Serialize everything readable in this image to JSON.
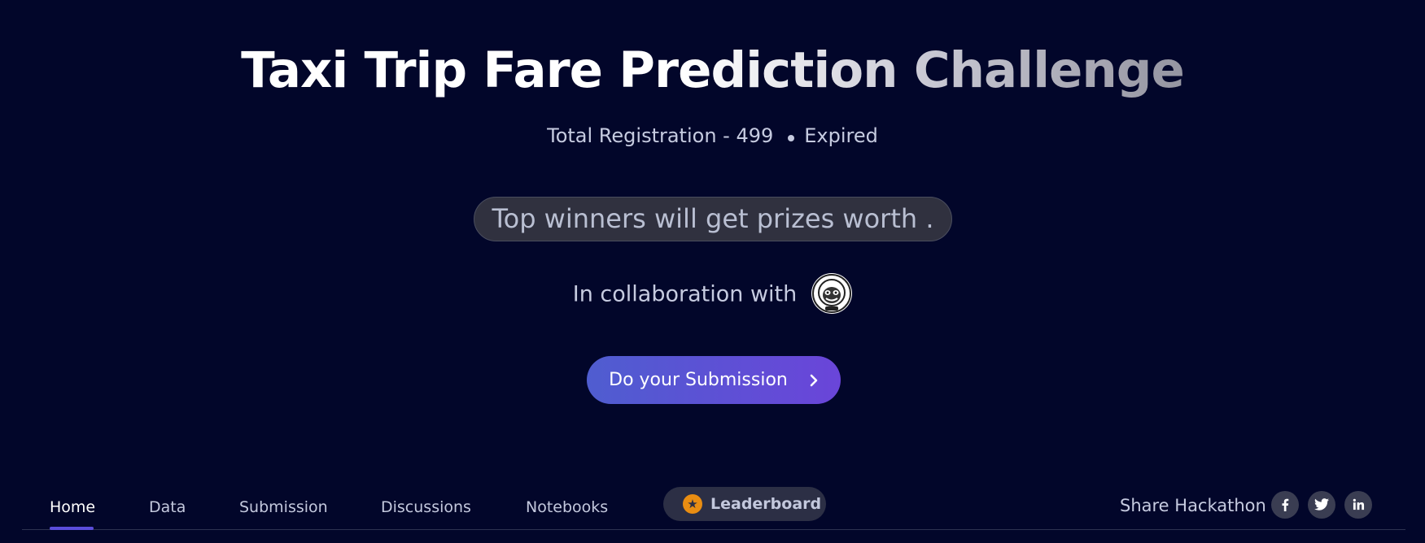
{
  "hero": {
    "title": "Taxi Trip Fare Prediction Challenge",
    "registration_text": "Total Registration - 499",
    "status": "Expired",
    "prize_text": "Top winners will get prizes worth .",
    "collab_text": "In collaboration with",
    "submit_label": "Do your Submission"
  },
  "nav": {
    "tabs": [
      {
        "label": "Home",
        "active": true
      },
      {
        "label": "Data"
      },
      {
        "label": "Submission"
      },
      {
        "label": "Discussions"
      },
      {
        "label": "Notebooks"
      }
    ],
    "leaderboard_label": "Leaderboard",
    "share_label": "Share Hackathon",
    "social_icons": [
      "facebook-icon",
      "twitter-icon",
      "linkedin-icon"
    ]
  },
  "colors": {
    "background": "#02062a",
    "button_gradient_start": "#4f5dd0",
    "button_gradient_end": "#6a45d9",
    "active_underline": "#5b4ddb",
    "leaderboard_star": "#e98d12"
  }
}
